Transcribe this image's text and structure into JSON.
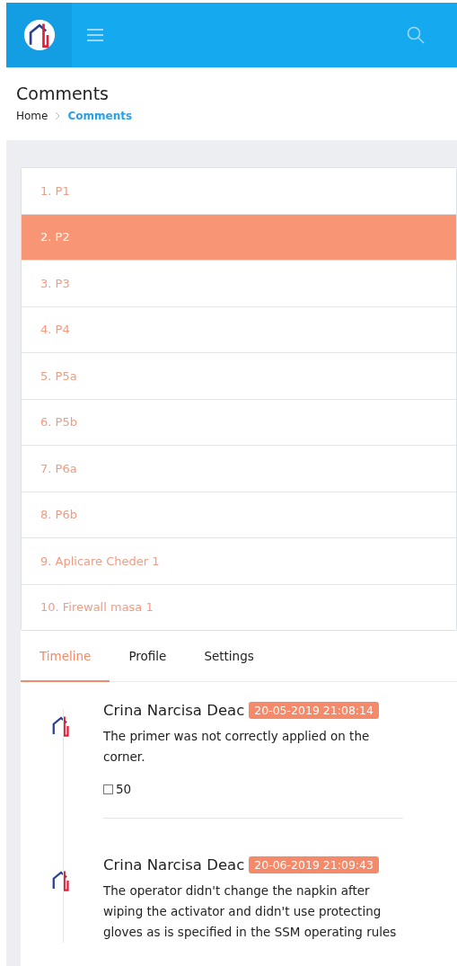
{
  "page": {
    "title": "Comments",
    "breadcrumb": [
      {
        "label": "Home",
        "selected": false
      },
      {
        "label": "Comments",
        "selected": true
      }
    ]
  },
  "items": [
    {
      "label": "1. P1",
      "selected": false
    },
    {
      "label": "2. P2",
      "selected": true
    },
    {
      "label": "3. P3",
      "selected": false
    },
    {
      "label": "4. P4",
      "selected": false
    },
    {
      "label": "5. P5a",
      "selected": false
    },
    {
      "label": "6. P5b",
      "selected": false
    },
    {
      "label": "7. P6a",
      "selected": false
    },
    {
      "label": "8. P6b",
      "selected": false
    },
    {
      "label": "9. Aplicare Cheder 1",
      "selected": false
    },
    {
      "label": "10. Firewall masa 1",
      "selected": false
    }
  ],
  "tabs": [
    {
      "label": "Timeline",
      "selected": true
    },
    {
      "label": "Profile",
      "selected": false
    },
    {
      "label": "Settings",
      "selected": false
    }
  ],
  "timeline": [
    {
      "author": "Crina Narcisa Deac",
      "time": "20-05-2019 21:08:14",
      "text": "The primer was not correctly applied on the corner.",
      "count": "50"
    },
    {
      "author": "Crina Narcisa Deac",
      "time": "20-06-2019 21:09:43",
      "text": "The operator didn't change the napkin after wiping the activator and didn't use protecting gloves as is specified in the SSM operating rules"
    }
  ]
}
